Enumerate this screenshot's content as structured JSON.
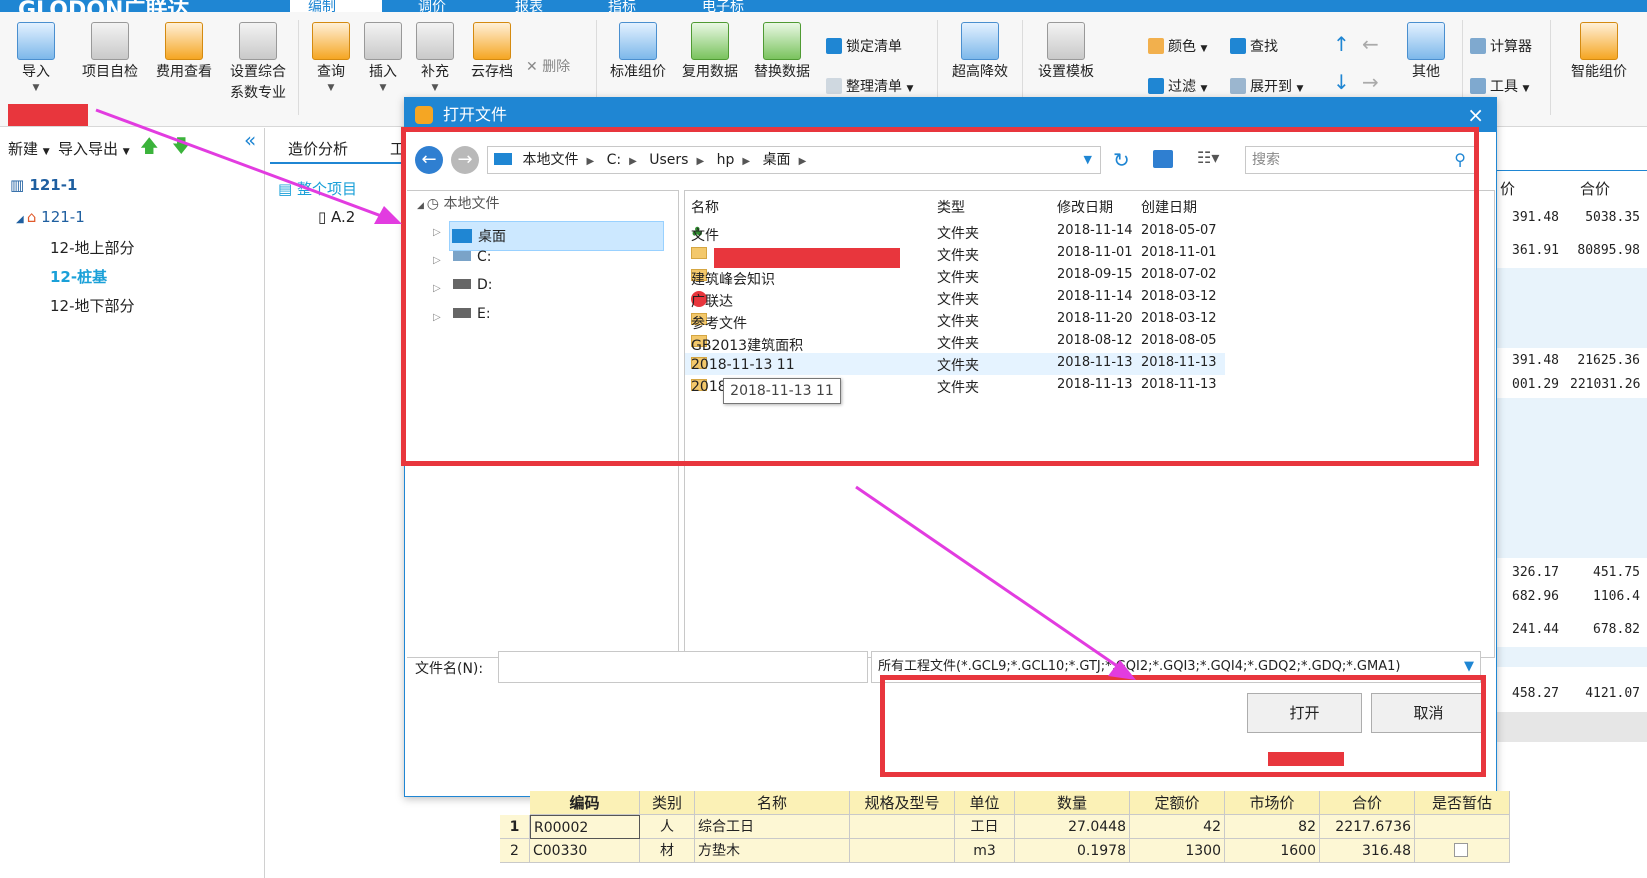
{
  "topbar": {
    "brand": "GLODON广联达",
    "menus": [
      "编制",
      "调价",
      "报表",
      "指标",
      "电子标"
    ]
  },
  "ribbon": {
    "big_buttons": [
      {
        "label": "导入",
        "icon": "import-icon"
      },
      {
        "label": "项目自检",
        "icon": "project-check-icon"
      },
      {
        "label": "费用查看",
        "icon": "fee-view-icon"
      },
      {
        "label": "设置综合",
        "sub": "系数专业",
        "icon": "settings-icon"
      },
      {
        "label": "查询",
        "icon": "query-icon"
      },
      {
        "label": "插入",
        "icon": "insert-icon"
      },
      {
        "label": "补充",
        "icon": "supplement-icon"
      },
      {
        "label": "云存档",
        "icon": "cloud-save-icon"
      },
      {
        "label": "标准组价",
        "icon": "standard-price-icon"
      },
      {
        "label": "复用数据",
        "icon": "reuse-data-icon"
      },
      {
        "label": "替换数据",
        "icon": "replace-data-icon"
      },
      {
        "label": "超高降效",
        "icon": "high-efficiency-icon"
      },
      {
        "label": "设置模板",
        "icon": "template-icon"
      },
      {
        "label": "其他",
        "icon": "other-icon"
      },
      {
        "label": "智能组价",
        "icon": "smart-price-icon"
      }
    ],
    "small_buttons": {
      "delete": "删除",
      "lock_list": "锁定清单",
      "tidy_list": "整理清单",
      "color": "颜色",
      "find": "查找",
      "filter": "过滤",
      "expand": "展开到",
      "calculator": "计算器",
      "tools": "工具"
    }
  },
  "left": {
    "toolbar": {
      "new": "新建",
      "import_export": "导入导出"
    },
    "root": "121-1",
    "child": "121-1",
    "items": [
      "12-地上部分",
      "12-桩基",
      "12-地下部分"
    ],
    "tab": "造价分析",
    "tab2": "工",
    "whole_project": "整个项目",
    "sub_node": "A.2"
  },
  "background_grid": {
    "headers": [
      "价",
      "合价"
    ],
    "rows": [
      [
        "391.48",
        "5038.35"
      ],
      [
        "361.91",
        "80895.98"
      ],
      [
        "391.48",
        "21625.36"
      ],
      [
        "001.29",
        "221031.26"
      ],
      [
        "326.17",
        "451.75"
      ],
      [
        "682.96",
        "1106.4"
      ],
      [
        "241.44",
        "678.82"
      ],
      [
        "458.27",
        "4121.07"
      ]
    ]
  },
  "dialog": {
    "title": "打开文件",
    "path": [
      "本地文件",
      "C:",
      "Users",
      "hp",
      "桌面"
    ],
    "search_placeholder": "搜索",
    "nav_tree": {
      "root": "本地文件",
      "items": [
        "桌面",
        "C:",
        "D:",
        "E:"
      ]
    },
    "columns": [
      "名称",
      "类型",
      "修改日期",
      "创建日期"
    ],
    "files": [
      {
        "name": "文件",
        "type": "文件夹",
        "modified": "2018-11-14",
        "created": "2018-05-07"
      },
      {
        "name": "",
        "type": "文件夹",
        "modified": "2018-11-01",
        "created": "2018-11-01"
      },
      {
        "name": "建筑峰会知识",
        "type": "文件夹",
        "modified": "2018-09-15",
        "created": "2018-07-02"
      },
      {
        "name": "广联达",
        "type": "文件夹",
        "modified": "2018-11-14",
        "created": "2018-03-12"
      },
      {
        "name": "参考文件",
        "type": "文件夹",
        "modified": "2018-11-20",
        "created": "2018-03-12"
      },
      {
        "name": "GB2013建筑面积",
        "type": "文件夹",
        "modified": "2018-08-12",
        "created": "2018-08-05"
      },
      {
        "name": "2018-11-13 11",
        "type": "文件夹",
        "modified": "2018-11-13",
        "created": "2018-11-13"
      },
      {
        "name": "2018-11-13 09",
        "type": "文件夹",
        "modified": "2018-11-13",
        "created": "2018-11-13"
      }
    ],
    "tooltip": "2018-11-13 11",
    "filename_label": "文件名(N):",
    "filename_value": "",
    "filetype": "所有工程文件(*.GCL9;*.GCL10;*.GTJ;*.GQI2;*.GQI3;*.GQI4;*.GDQ2;*.GDQ;*.GMA1)",
    "open": "打开",
    "cancel": "取消"
  },
  "bottom_table": {
    "headers": [
      "编码",
      "类别",
      "名称",
      "规格及型号",
      "单位",
      "数量",
      "定额价",
      "市场价",
      "合价",
      "是否暂估"
    ],
    "rows": [
      {
        "no": "1",
        "code": "R00002",
        "cat": "人",
        "name": "综合工日",
        "spec": "",
        "unit": "工日",
        "qty": "27.0448",
        "quota": "42",
        "market": "82",
        "total": "2217.6736"
      },
      {
        "no": "2",
        "code": "C00330",
        "cat": "材",
        "name": "方垫木",
        "spec": "",
        "unit": "m3",
        "qty": "0.1978",
        "quota": "1300",
        "market": "1600",
        "total": "316.48"
      }
    ]
  },
  "colors": {
    "accent": "#1f86d3",
    "annotation": "#e8363d",
    "arrow": "#e23ce0"
  }
}
